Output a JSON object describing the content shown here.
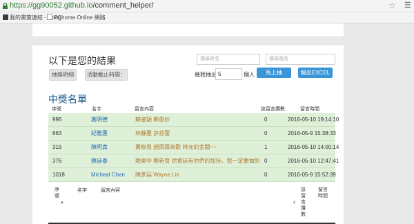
{
  "browser": {
    "url_host": "https://gg90052.github.io",
    "url_path": "/comment_helper/",
    "star_icon": "star-icon",
    "menu_icon": "menu-icon"
  },
  "bookmarks": [
    {
      "label": "我的書簽連結 - Goog",
      "icon": "bookmark-icon"
    },
    {
      "label": "PChome Online 網路",
      "icon": "page-icon"
    }
  ],
  "results": {
    "title": "以下是您的結果",
    "terms_button": "抽獎明細",
    "deadline_button": "活動截止時間：",
    "search_name_placeholder": "搜尋姓名",
    "search_comment_placeholder": "搜尋留言",
    "draw_label": "幾我抽出",
    "draw_count": "5",
    "draw_unit": "個人",
    "draw_button": "馬上抽",
    "export_button": "輸出EXCEL"
  },
  "winners": {
    "title": "中獎名單",
    "headers": {
      "no": "序號",
      "name": "名字",
      "content": "留言內容",
      "count": "該留言讚數",
      "time": "留言時間"
    },
    "rows": [
      {
        "no": "996",
        "name": "謝明德",
        "content": "蘇姿穎 鄭俊妙",
        "count": "0",
        "time": "2016-05-10 19:14:10"
      },
      {
        "no": "863",
        "name": "紀雅惠",
        "content": "林靜惠 許芬蕾",
        "count": "0",
        "time": "2016-05-9 15:38:33"
      },
      {
        "no": "319",
        "name": "陳明真",
        "content": "黃筱恩 趙雨霖來歡 林允的金關~~",
        "count": "1",
        "time": "2016-05-10 14:00:14"
      },
      {
        "no": "376",
        "name": "陳廷泰",
        "content": "賴東中 鄭新育 徐睿廷有你們的加持，我一定要抽到",
        "count": "0",
        "time": "2016-05-10 12:47:41"
      },
      {
        "no": "1018",
        "name": "Micheal Chen",
        "content": "陳彥廷 Wayne Lin",
        "count": "0",
        "time": "2016-05-9 15:52:39"
      }
    ]
  },
  "comments_table": {
    "headers": {
      "no": "序號",
      "name": "名字",
      "content": "留言內容",
      "count": "該留言讚數",
      "time": "留言時間"
    },
    "sort_indicator": "▲",
    "sort_indicator_2": "⇕"
  }
}
